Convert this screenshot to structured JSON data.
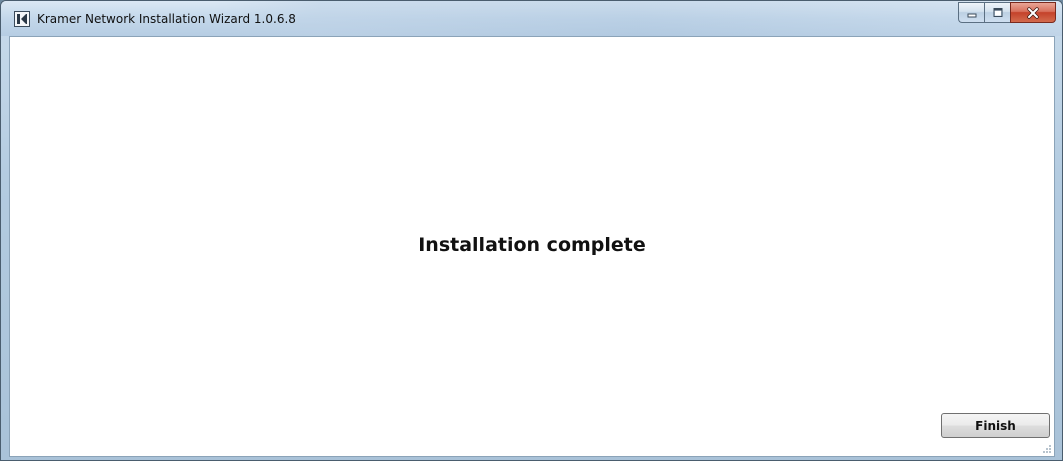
{
  "window": {
    "title": "Kramer Network Installation Wizard 1.0.6.8",
    "icon": "kramer-logo-icon"
  },
  "caption": {
    "minimize_icon": "minimize-icon",
    "maximize_icon": "maximize-icon",
    "close_icon": "close-icon"
  },
  "main": {
    "heading": "Installation complete"
  },
  "footer": {
    "finish_label": "Finish"
  },
  "colors": {
    "close_button": "#c4412a",
    "client_background": "#ffffff"
  }
}
